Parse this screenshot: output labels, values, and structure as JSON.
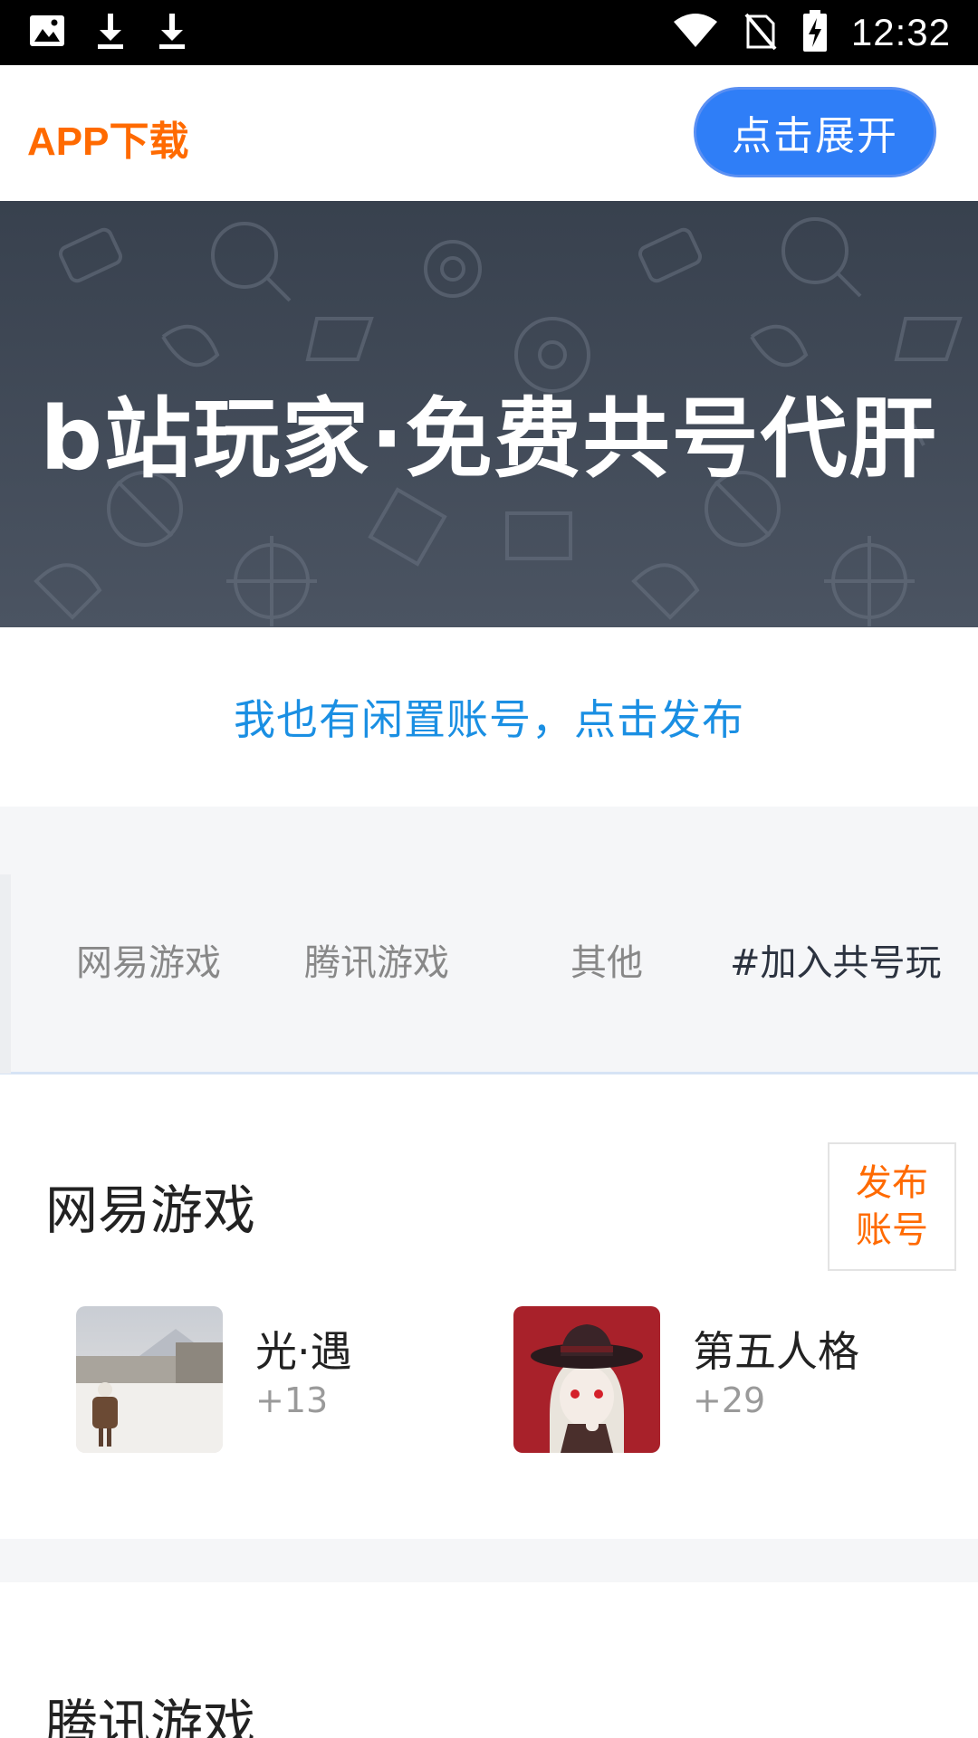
{
  "status_bar": {
    "time": "12:32",
    "left_icons": [
      "image-icon",
      "download-icon",
      "download-icon"
    ],
    "right_icons": [
      "wifi-icon",
      "no-sim-icon",
      "battery-charging-icon"
    ]
  },
  "header": {
    "app_download_label": "APP下载",
    "expand_button_label": "点击展开",
    "accent_color": "#ff6a00",
    "button_color": "#2f7ef7"
  },
  "banner": {
    "title": "b站玩家·免费共号代肝"
  },
  "publish_link": {
    "label": "我也有闲置账号，点击发布",
    "color": "#1a8fe3"
  },
  "tabs": [
    {
      "label": "网易游戏",
      "active": false
    },
    {
      "label": "腾讯游戏",
      "active": false
    },
    {
      "label": "其他",
      "active": false
    },
    {
      "label": "#加入共号玩",
      "active": true
    }
  ],
  "sections": [
    {
      "title": "网易游戏",
      "publish_button_line1": "发布",
      "publish_button_line2": "账号",
      "games": [
        {
          "name": "光·遇",
          "count": "+13"
        },
        {
          "name": "第五人格",
          "count": "+29"
        }
      ]
    },
    {
      "title": "腾讯游戏"
    }
  ]
}
